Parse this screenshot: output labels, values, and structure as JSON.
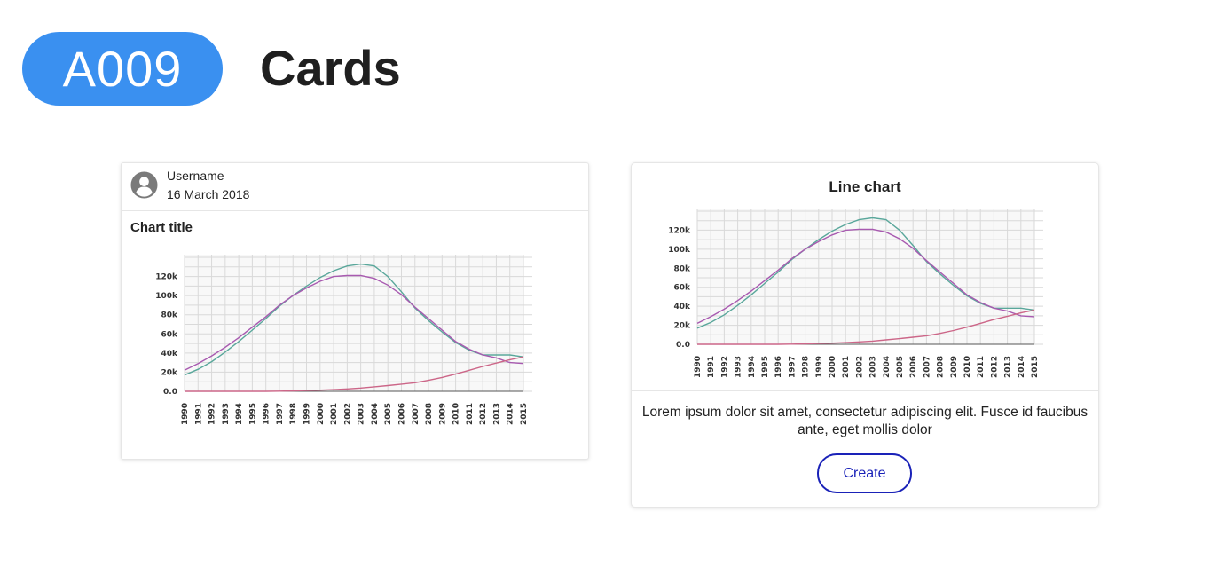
{
  "badge": "A009",
  "page_title": "Cards",
  "card1": {
    "username": "Username",
    "date": "16 March 2018",
    "chart_title": "Chart title"
  },
  "card2": {
    "chart_title": "Line chart",
    "body_text": "Lorem ipsum dolor sit amet, consectetur adipiscing elit. Fusce id faucibus ante, eget mollis dolor",
    "button_label": "Create"
  },
  "colors": {
    "badge": "#3a90f0",
    "button": "#1a22b8",
    "series_teal": "#5aa79b",
    "series_purple": "#a85ab0",
    "series_pink": "#cc6688"
  },
  "chart_data": [
    {
      "type": "line",
      "title": "Chart title",
      "x": [
        1990,
        1991,
        1992,
        1993,
        1994,
        1995,
        1996,
        1997,
        1998,
        1999,
        2000,
        2001,
        2002,
        2003,
        2004,
        2005,
        2006,
        2007,
        2008,
        2009,
        2010,
        2011,
        2012,
        2013,
        2014,
        2015
      ],
      "ylim": [
        0,
        140000
      ],
      "yticks": [
        "0.0",
        "20k",
        "40k",
        "60k",
        "80k",
        "100k",
        "120k"
      ],
      "grid": true,
      "series": [
        {
          "color": "#5aa79b",
          "values": [
            17000,
            23000,
            31000,
            41000,
            52000,
            64000,
            76000,
            89000,
            100000,
            110000,
            119000,
            126000,
            131000,
            133000,
            131000,
            120000,
            104000,
            87000,
            74000,
            62000,
            51000,
            43000,
            38000,
            38000,
            38000,
            36000
          ]
        },
        {
          "color": "#a85ab0",
          "values": [
            22000,
            29000,
            37000,
            46000,
            56000,
            67000,
            78000,
            90000,
            100000,
            108000,
            115000,
            120000,
            121000,
            121000,
            118000,
            111000,
            101000,
            88000,
            76000,
            64000,
            52000,
            44000,
            38000,
            35000,
            30000,
            29000
          ]
        },
        {
          "color": "#cc6688",
          "values": [
            0,
            0,
            0,
            0,
            0,
            0,
            0,
            200,
            500,
            800,
            1200,
            1800,
            2500,
            3400,
            4700,
            6000,
            7500,
            9000,
            11500,
            14500,
            18000,
            22000,
            26000,
            29500,
            33000,
            36000
          ]
        }
      ]
    },
    {
      "type": "line",
      "title": "Line chart",
      "x": [
        1990,
        1991,
        1992,
        1993,
        1994,
        1995,
        1996,
        1997,
        1998,
        1999,
        2000,
        2001,
        2002,
        2003,
        2004,
        2005,
        2006,
        2007,
        2008,
        2009,
        2010,
        2011,
        2012,
        2013,
        2014,
        2015
      ],
      "ylim": [
        0,
        140000
      ],
      "yticks": [
        "0.0",
        "20k",
        "40k",
        "60k",
        "80k",
        "100k",
        "120k"
      ],
      "grid": true,
      "series": [
        {
          "color": "#5aa79b",
          "values": [
            17000,
            23000,
            31000,
            41000,
            52000,
            64000,
            76000,
            89000,
            100000,
            110000,
            119000,
            126000,
            131000,
            133000,
            131000,
            120000,
            104000,
            87000,
            74000,
            62000,
            51000,
            43000,
            38000,
            38000,
            38000,
            36000
          ]
        },
        {
          "color": "#a85ab0",
          "values": [
            22000,
            29000,
            37000,
            46000,
            56000,
            67000,
            78000,
            90000,
            100000,
            108000,
            115000,
            120000,
            121000,
            121000,
            118000,
            111000,
            101000,
            88000,
            76000,
            64000,
            52000,
            44000,
            38000,
            35000,
            30000,
            29000
          ]
        },
        {
          "color": "#cc6688",
          "values": [
            0,
            0,
            0,
            0,
            0,
            0,
            0,
            200,
            500,
            800,
            1200,
            1800,
            2500,
            3400,
            4700,
            6000,
            7500,
            9000,
            11500,
            14500,
            18000,
            22000,
            26000,
            29500,
            33000,
            36000
          ]
        }
      ]
    }
  ]
}
